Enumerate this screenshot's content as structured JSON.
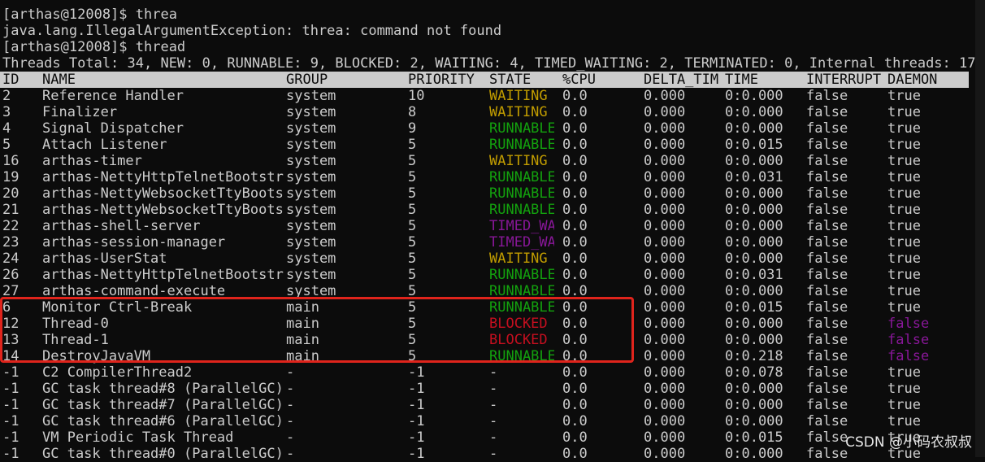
{
  "terminal": {
    "lines": [
      "[arthas@12008]$ threa",
      "java.lang.IllegalArgumentException: threa: command not found",
      "[arthas@12008]$ thread",
      "Threads Total: 34, NEW: 0, RUNNABLE: 9, BLOCKED: 2, WAITING: 4, TIMED_WAITING: 2, TERMINATED: 0, Internal threads: 17"
    ]
  },
  "table": {
    "headers": [
      "ID",
      "NAME",
      "GROUP",
      "PRIORITY",
      "STATE",
      "%CPU",
      "DELTA_TIM",
      "TIME",
      "INTERRUPT",
      "DAEMON"
    ],
    "rows": [
      [
        "2",
        "Reference Handler",
        "system",
        "10",
        "WAITING",
        "0.0",
        "0.000",
        "0:0.000",
        "false",
        "true"
      ],
      [
        "3",
        "Finalizer",
        "system",
        "8",
        "WAITING",
        "0.0",
        "0.000",
        "0:0.000",
        "false",
        "true"
      ],
      [
        "4",
        "Signal Dispatcher",
        "system",
        "9",
        "RUNNABLE",
        "0.0",
        "0.000",
        "0:0.000",
        "false",
        "true"
      ],
      [
        "5",
        "Attach Listener",
        "system",
        "5",
        "RUNNABLE",
        "0.0",
        "0.000",
        "0:0.015",
        "false",
        "true"
      ],
      [
        "16",
        "arthas-timer",
        "system",
        "5",
        "WAITING",
        "0.0",
        "0.000",
        "0:0.000",
        "false",
        "true"
      ],
      [
        "19",
        "arthas-NettyHttpTelnetBootstr",
        "system",
        "5",
        "RUNNABLE",
        "0.0",
        "0.000",
        "0:0.031",
        "false",
        "true"
      ],
      [
        "20",
        "arthas-NettyWebsocketTtyBoots",
        "system",
        "5",
        "RUNNABLE",
        "0.0",
        "0.000",
        "0:0.000",
        "false",
        "true"
      ],
      [
        "21",
        "arthas-NettyWebsocketTtyBoots",
        "system",
        "5",
        "RUNNABLE",
        "0.0",
        "0.000",
        "0:0.000",
        "false",
        "true"
      ],
      [
        "22",
        "arthas-shell-server",
        "system",
        "5",
        "TIMED_WA",
        "0.0",
        "0.000",
        "0:0.000",
        "false",
        "true"
      ],
      [
        "23",
        "arthas-session-manager",
        "system",
        "5",
        "TIMED_WA",
        "0.0",
        "0.000",
        "0:0.000",
        "false",
        "true"
      ],
      [
        "24",
        "arthas-UserStat",
        "system",
        "5",
        "WAITING",
        "0.0",
        "0.000",
        "0:0.000",
        "false",
        "true"
      ],
      [
        "26",
        "arthas-NettyHttpTelnetBootstr",
        "system",
        "5",
        "RUNNABLE",
        "0.0",
        "0.000",
        "0:0.031",
        "false",
        "true"
      ],
      [
        "27",
        "arthas-command-execute",
        "system",
        "5",
        "RUNNABLE",
        "0.0",
        "0.000",
        "0:0.000",
        "false",
        "true"
      ],
      [
        "6",
        "Monitor Ctrl-Break",
        "main",
        "5",
        "RUNNABLE",
        "0.0",
        "0.000",
        "0:0.015",
        "false",
        "true"
      ],
      [
        "12",
        "Thread-0",
        "main",
        "5",
        "BLOCKED",
        "0.0",
        "0.000",
        "0:0.000",
        "false",
        "false"
      ],
      [
        "13",
        "Thread-1",
        "main",
        "5",
        "BLOCKED",
        "0.0",
        "0.000",
        "0:0.000",
        "false",
        "false"
      ],
      [
        "14",
        "DestroyJavaVM",
        "main",
        "5",
        "RUNNABLE",
        "0.0",
        "0.000",
        "0:0.218",
        "false",
        "false"
      ],
      [
        "-1",
        "C2 CompilerThread2",
        "-",
        "-1",
        "-",
        "0.0",
        "0.000",
        "0:0.078",
        "false",
        "true"
      ],
      [
        "-1",
        "GC task thread#8 (ParallelGC)",
        "-",
        "-1",
        "-",
        "0.0",
        "0.000",
        "0:0.000",
        "false",
        "true"
      ],
      [
        "-1",
        "GC task thread#7 (ParallelGC)",
        "-",
        "-1",
        "-",
        "0.0",
        "0.000",
        "0:0.000",
        "false",
        "true"
      ],
      [
        "-1",
        "GC task thread#6 (ParallelGC)",
        "-",
        "-1",
        "-",
        "0.0",
        "0.000",
        "0:0.000",
        "false",
        "true"
      ],
      [
        "-1",
        "VM Periodic Task Thread",
        "-",
        "-1",
        "-",
        "0.0",
        "0.000",
        "0:0.015",
        "false",
        "true"
      ],
      [
        "-1",
        "GC task thread#0 (ParallelGC)",
        "-",
        "-1",
        "-",
        "0.0",
        "0.000",
        "0:0.000",
        "false",
        "true"
      ]
    ]
  },
  "colors": {
    "background": "#0c0c0c",
    "text": "#cccccc",
    "header_bg": "#cccccc",
    "WAITING": "#c19c00",
    "RUNNABLE": "#13a10e",
    "TIMED_WA": "#881798",
    "BLOCKED": "#c50f1f",
    "daemon_false": "#881798",
    "highlight_box": "#e0241c"
  },
  "watermark": "CSDN @小码农叔叔"
}
